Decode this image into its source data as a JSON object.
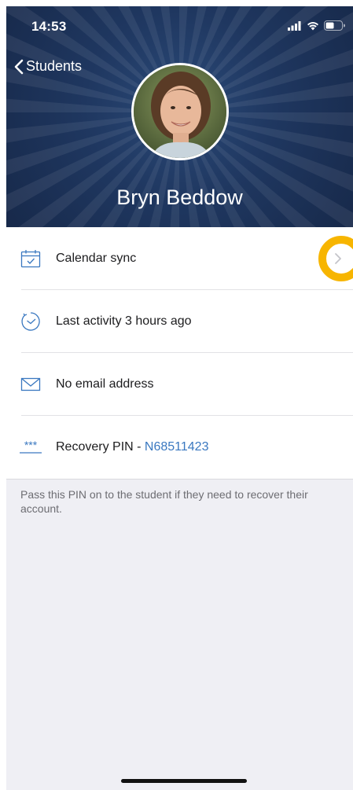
{
  "status_bar": {
    "time": "14:53"
  },
  "nav": {
    "back_label": "Students"
  },
  "profile": {
    "name": "Bryn Beddow"
  },
  "rows": {
    "calendar": {
      "label": "Calendar sync",
      "icon": "calendar-icon"
    },
    "activity": {
      "label": "Last activity 3 hours ago",
      "icon": "clock-icon"
    },
    "email": {
      "label": "No email address",
      "icon": "envelope-icon"
    },
    "pin": {
      "icon_text": "***",
      "label": "Recovery PIN - ",
      "value": "N68511423"
    }
  },
  "note": "Pass this PIN on to the student if they need to recover their account.",
  "colors": {
    "header": "#1f3760",
    "accent_blue": "#3a78c0",
    "highlight": "#f7b500"
  }
}
